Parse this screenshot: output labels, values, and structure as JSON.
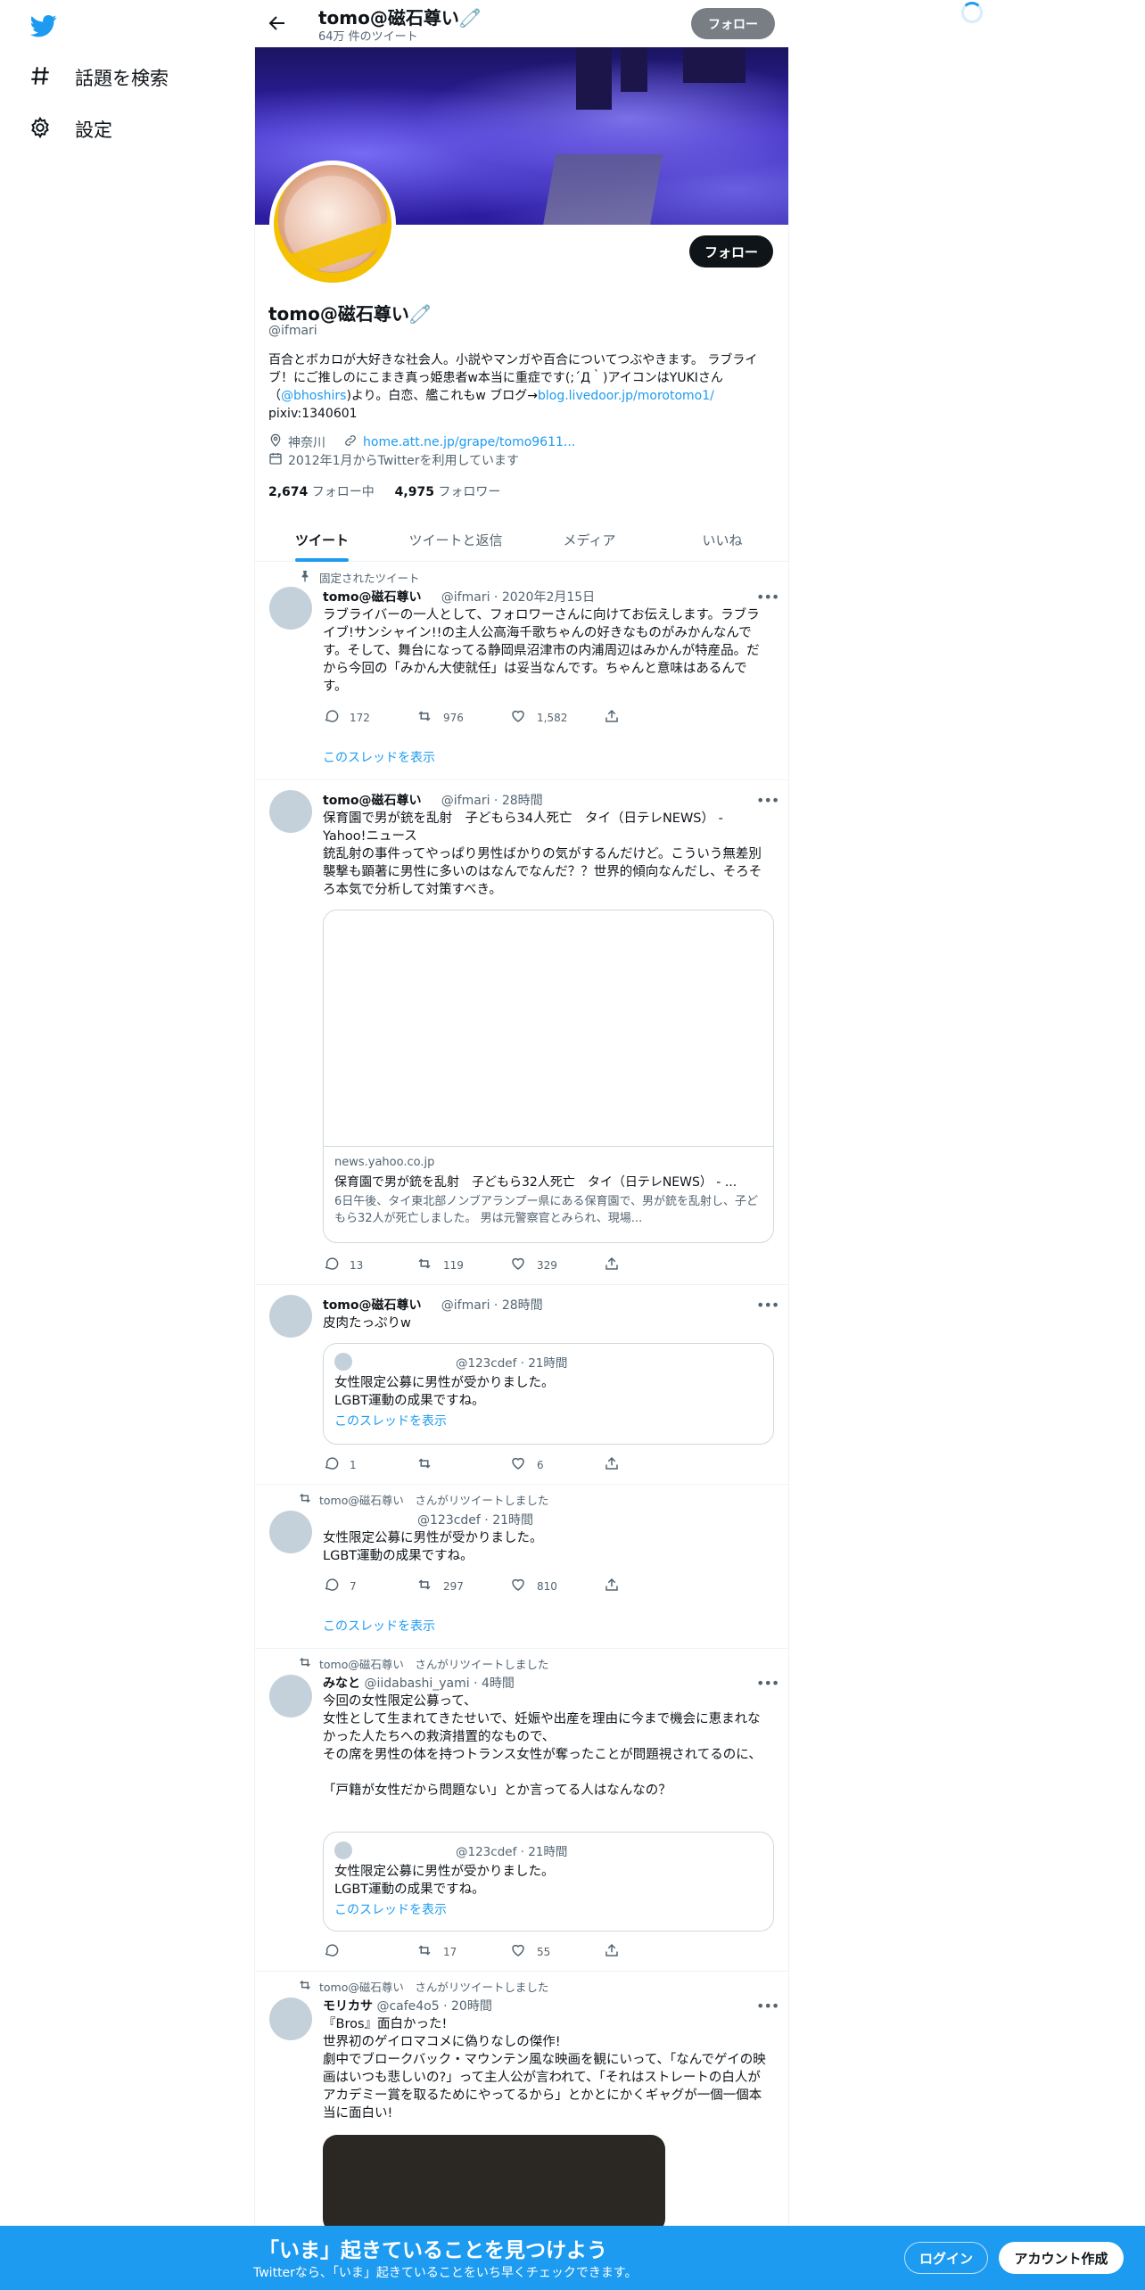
{
  "sidebar": {
    "logo": "twitter-bird-icon",
    "items": [
      {
        "label": "話題を検索",
        "icon": "hashtag-icon"
      },
      {
        "label": "設定",
        "icon": "gear-icon"
      }
    ]
  },
  "header": {
    "name": "tomo@磁石尊い🧷",
    "tweet_count": "64万 件のツイート",
    "follow_label": "フォロー"
  },
  "profile": {
    "name": "tomo@磁石尊い🧷",
    "handle": "@ifmari",
    "follow_label": "フォロー",
    "bio_1": "百合とボカロが大好きな社会人。小説やマンガや百合についてつぶやきます。 ラブライブ！にご推しのにこまき真っ姫患者w本当に重症です(;´Д｀)アイコンはYUKIさん（",
    "bio_mention": "@bhoshirs",
    "bio_2": ")より。白恋、艦これもw ブログ→",
    "bio_link": "blog.livedoor.jp/morotomo1/",
    "bio_3": "pixiv:1340601",
    "location": "神奈川",
    "website": "home.att.ne.jp/grape/tomo9611...",
    "joined": "2012年1月からTwitterを利用しています",
    "following_count": "2,674",
    "following_label": "フォロー中",
    "followers_count": "4,975",
    "followers_label": "フォロワー"
  },
  "tabs": [
    "ツイート",
    "ツイートと返信",
    "メディア",
    "いいね"
  ],
  "tweets": [
    {
      "pinned_label": "固定されたツイート",
      "name": "tomo@磁石尊い",
      "meta": "@ifmari · 2020年2月15日",
      "text": "ラブライバーの一人として、フォロワーさんに向けてお伝えします。ラブライブ!サンシャイン!!の主人公高海千歌ちゃんの好きなものがみかんなんです。そして、舞台になってる静岡県沼津市の内浦周辺はみかんが特産品。だから今回の「みかん大使就任」は妥当なんです。ちゃんと意味はあるんです。",
      "replies": "172",
      "retweets": "976",
      "likes": "1,582",
      "thread_label": "このスレッドを表示"
    },
    {
      "name": "tomo@磁石尊い",
      "meta": "@ifmari · 28時間",
      "text_1": "保育園で男が銃を乱射　子どもら34人死亡　タイ（日テレNEWS） - Yahoo!ニュース",
      "text_2": "銃乱射の事件ってやっぱり男性ばかりの気がするんだけど。こういう無差別襲撃も顕著に男性に多いのはなんでなんだ？？世界的傾向なんだし、そろそろ本気で分析して対策すべき。",
      "card_domain": "news.yahoo.co.jp",
      "card_title": "保育園で男が銃を乱射　子どもら32人死亡　タイ（日テレNEWS） - ...",
      "card_desc": "6日午後、タイ東北部ノンブアランプー県にある保育園で、男が銃を乱射し、子どもら32人が死亡しました。 男は元警察官とみられ、現場...",
      "replies": "13",
      "retweets": "119",
      "likes": "329"
    },
    {
      "name": "tomo@磁石尊い",
      "meta": "@ifmari · 28時間",
      "text": "皮肉たっぷりw",
      "quote_meta": "@123cdef · 21時間",
      "quote_text_1": "女性限定公募に男性が受かりました。",
      "quote_text_2": "LGBT運動の成果ですね。",
      "quote_thread": "このスレッドを表示",
      "replies": "1",
      "retweets": "",
      "likes": "6"
    },
    {
      "retweet_label": "tomo@磁石尊い　さんがリツイートしました",
      "meta": "@123cdef · 21時間",
      "text_1": "女性限定公募に男性が受かりました。",
      "text_2": "LGBT運動の成果ですね。",
      "replies": "7",
      "retweets": "297",
      "likes": "810",
      "thread_label": "このスレッドを表示"
    },
    {
      "retweet_label": "tomo@磁石尊い　さんがリツイートしました",
      "name": "みなと",
      "meta": "@iidabashi_yami · 4時間",
      "text_1": "今回の女性限定公募って、",
      "text_2": "女性として生まれてきたせいで、妊娠や出産を理由に今まで機会に恵まれなかった人たちへの救済措置的なもので、",
      "text_3": "その席を男性の体を持つトランス女性が奪ったことが問題視されてるのに、",
      "text_4": "「戸籍が女性だから問題ない」とか言ってる人はなんなの？",
      "quote_meta": "@123cdef · 21時間",
      "quote_text_1": "女性限定公募に男性が受かりました。",
      "quote_text_2": "LGBT運動の成果ですね。",
      "quote_thread": "このスレッドを表示",
      "replies": "",
      "retweets": "17",
      "likes": "55"
    },
    {
      "retweet_label": "tomo@磁石尊い　さんがリツイートしました",
      "name": "モリカサ",
      "meta": "@cafe4o5 · 20時間",
      "text_1": "『Bros』面白かった!",
      "text_2": "世界初のゲイロマコメに偽りなしの傑作!",
      "text_3": "劇中でブロークバック・マウンテン風な映画を観にいって、「なんでゲイの映画はいつも悲しいの?」って主人公が言われて、「それはストレートの白人がアカデミー賞を取るためにやってるから」とかとにかくギャグが一個一個本当に面白い!"
    }
  ],
  "bottom_bar": {
    "title": "「いま」起きていることを見つけよう",
    "subtitle": "Twitterなら、「いま」起きていることをいち早くチェックできます。",
    "login": "ログイン",
    "signup": "アカウント作成"
  },
  "colors": {
    "accent": "#1d9bf0",
    "text": "#0f1419",
    "muted": "#536471",
    "border": "#eff3f4"
  }
}
